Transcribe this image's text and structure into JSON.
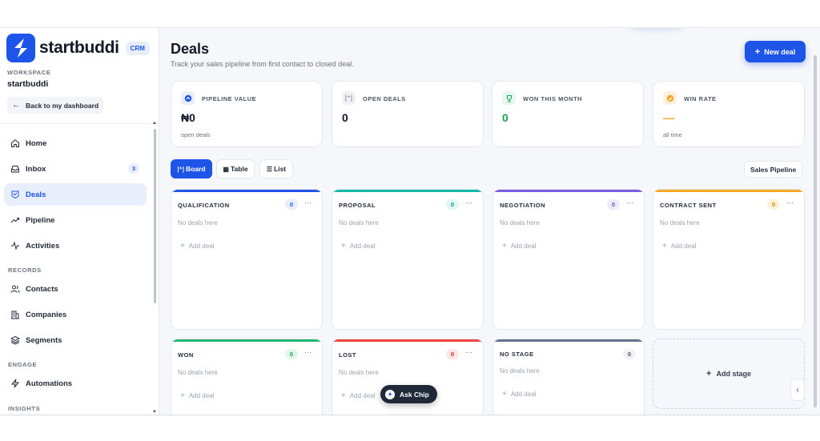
{
  "brand": {
    "name": "startbuddi",
    "badge": "CRM"
  },
  "workspace": {
    "label": "WORKSPACE",
    "name": "startbuddi"
  },
  "back_button": "Back to my dashboard",
  "nav": {
    "home": "Home",
    "inbox": "Inbox",
    "inbox_count": "3",
    "deals": "Deals",
    "pipeline": "Pipeline",
    "activities": "Activities",
    "records_label": "RECORDS",
    "contacts": "Contacts",
    "companies": "Companies",
    "segments": "Segments",
    "engage_label": "ENGAGE",
    "automations": "Automations",
    "insights_label": "INSIGHTS"
  },
  "header": {
    "title": "Deals",
    "subtitle": "Track your sales pipeline from first contact to closed deal.",
    "new_deal": "New deal"
  },
  "stats": [
    {
      "label": "PIPELINE VALUE",
      "value": "₦0",
      "sub": "open deals",
      "icon": "pipeline-icon"
    },
    {
      "label": "OPEN DEALS",
      "value": "0",
      "sub": "",
      "icon": "open-deals-icon"
    },
    {
      "label": "WON THIS MONTH",
      "value": "0",
      "sub": "",
      "icon": "trophy-icon"
    },
    {
      "label": "WIN RATE",
      "value": "—",
      "sub": "all time",
      "icon": "win-rate-icon"
    }
  ],
  "views": {
    "board": "Board",
    "table": "Table",
    "list": "List",
    "pipeline_select": "Sales Pipeline"
  },
  "columns": [
    {
      "name": "QUALIFICATION",
      "count": "0",
      "empty": "No deals here",
      "add": "Add deal",
      "color": "#1e55e8"
    },
    {
      "name": "PROPOSAL",
      "count": "0",
      "empty": "No deals here",
      "add": "Add deal",
      "color": "#14b8a6"
    },
    {
      "name": "NEGOTIATION",
      "count": "0",
      "empty": "No deals here",
      "add": "Add deal",
      "color": "#7c5ce0"
    },
    {
      "name": "CONTRACT SENT",
      "count": "0",
      "empty": "No deals here",
      "add": "Add deal",
      "color": "#f5a623"
    },
    {
      "name": "WON",
      "count": "0",
      "empty": "No deals here",
      "add": "Add deal",
      "color": "#22b573"
    },
    {
      "name": "LOST",
      "count": "0",
      "empty": "No deals here",
      "add": "Add deal",
      "color": "#ef4444"
    },
    {
      "name": "NO STAGE",
      "count": "0",
      "empty": "No deals here",
      "add": "Add deal",
      "color": "#64748b"
    }
  ],
  "add_stage": "Add stage",
  "ask_chip": "Ask Chip",
  "colors": {
    "accent": "#1e55e8"
  }
}
